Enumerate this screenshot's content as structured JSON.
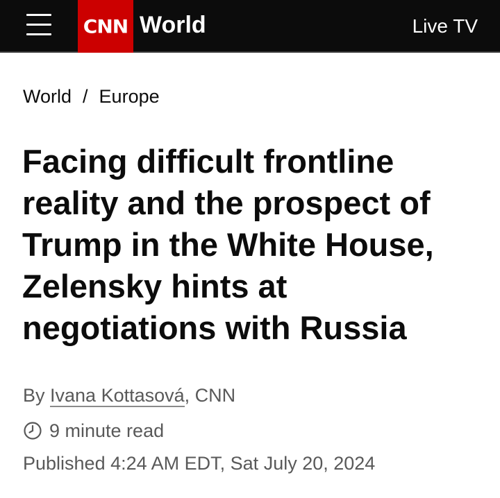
{
  "header": {
    "logo_text": "CNN",
    "section": "World",
    "live_tv": "Live TV",
    "brand_color": "#cc0000",
    "background_color": "#0c0c0c"
  },
  "breadcrumb": {
    "items": [
      "World",
      "Europe"
    ],
    "separator": "/"
  },
  "article": {
    "headline": "Facing difficult frontline reality and the prospect of Trump in the White House, Zelensky hints at negotiations with Russia",
    "byline_prefix": "By ",
    "author": "Ivana Kottasová",
    "byline_suffix": ", CNN",
    "read_time": "9 minute read",
    "published": "Published 4:24 AM EDT, Sat July 20, 2024"
  },
  "icons": {
    "menu": "hamburger-menu-icon",
    "clock": "clock-icon"
  }
}
